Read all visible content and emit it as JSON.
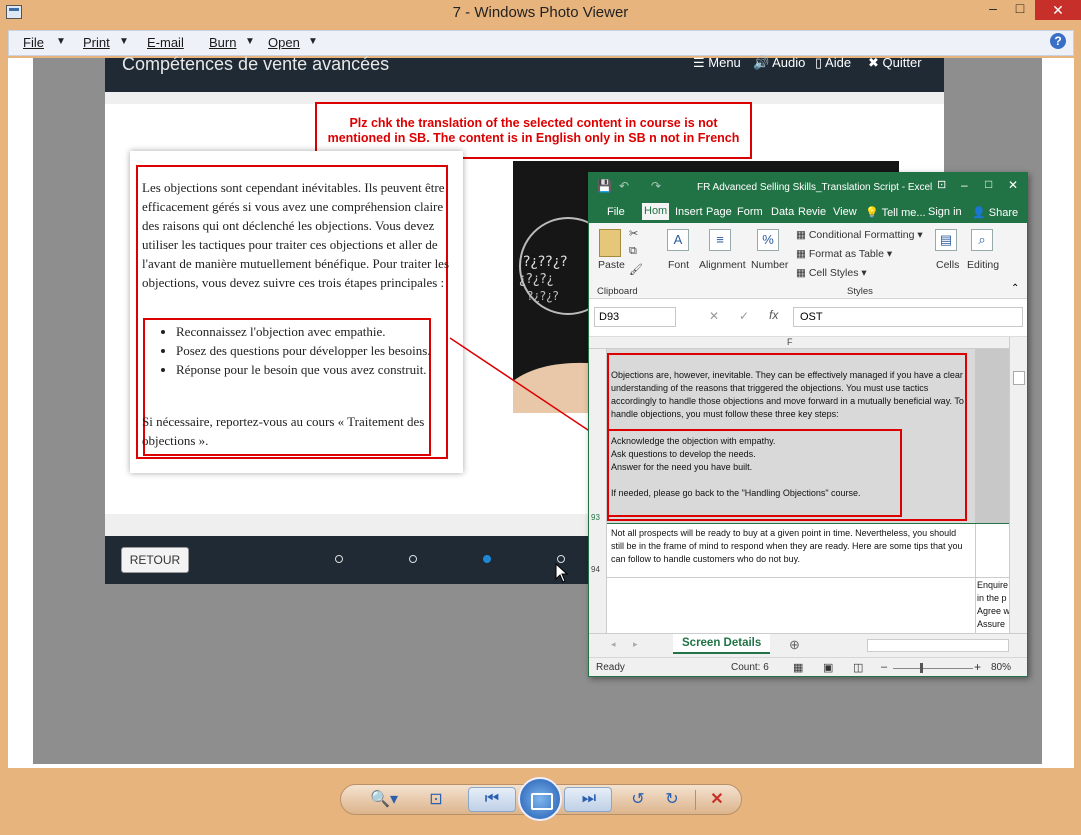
{
  "window": {
    "title": "7 - Windows Photo Viewer",
    "minimize": "–",
    "maximize": "□",
    "close": "✕"
  },
  "menu": {
    "items": [
      {
        "label": "File"
      },
      {
        "label": "Print"
      },
      {
        "label": "E-mail"
      },
      {
        "label": "Burn"
      },
      {
        "label": "Open"
      }
    ],
    "help": "?"
  },
  "slide": {
    "title": "Compétences de vente avancées",
    "header_items": [
      "☰ Menu",
      "🔊 Audio",
      "▯ Aide",
      "✖ Quitter"
    ],
    "note": "Plz chk the translation of the selected content in course is not mentioned in SB. The content is in English only in SB n not in French",
    "paragraph": "Les objections sont cependant inévitables. Ils peuvent être efficacement gérés si vous avez une compréhension claire des raisons qui ont déclenché les objections. Vous devez utiliser les tactiques pour traiter ces objections et aller de l'avant de manière mutuellement bénéfique. Pour traiter les objections, vous devez suivre ces trois étapes principales :",
    "bullets": [
      "Reconnaissez l'objection avec empathie.",
      "Posez des questions pour développer les besoins.",
      "Réponse pour le besoin que vous avez construit."
    ],
    "footnote": "Si nécessaire, reportez-vous au cours « Traitement des objections ».",
    "retour": "RETOUR"
  },
  "excel": {
    "title": "FR Advanced Selling Skills_Translation Script - Excel",
    "sign_in": "Sign in",
    "share": "Share",
    "tabs": [
      "File",
      "Hom",
      "Insert",
      "Page",
      "Form",
      "Data",
      "Revie",
      "View",
      "Tell me..."
    ],
    "ribbon": {
      "paste": "Paste",
      "clipboard": "Clipboard",
      "font": "Font",
      "alignment": "Alignment",
      "number": "Number",
      "number_icon": "%",
      "cond_format": "Conditional Formatting",
      "format_table": "Format as Table",
      "cell_styles": "Cell Styles",
      "styles": "Styles",
      "cells": "Cells",
      "editing": "Editing"
    },
    "name_box": "D93",
    "fx": "fx",
    "formula_value": "OST",
    "column_header": "F",
    "row_93_para": "Objections are, however, inevitable. They can be effectively managed if you have a clear understanding of the reasons that triggered the objections. You must use tactics accordingly to handle those objections and move forward in a mutually beneficial way. To handle objections, you must follow these three key steps:",
    "row_93_lines": [
      "Acknowledge the objection with empathy.",
      "Ask questions to develop the needs.",
      "Answer for the need you have built."
    ],
    "row_93_foot": "If needed, please go back to the \"Handling Objections\" course.",
    "row_94_text": "Not all prospects will be ready to buy at a given point in time. Nevertheless, you should still be in the frame of mind to respond when they are ready. Here are some tips that you can follow to handle customers who do not buy.",
    "row_95_side": [
      "Enquire",
      "in the p",
      "Agree w",
      "Assure"
    ],
    "row_numbers": [
      "93",
      "94"
    ],
    "sheet_tab": "Screen Details",
    "status_ready": "Ready",
    "status_count": "Count: 6",
    "zoom": "80%"
  },
  "toolbar": {
    "zoom": "🔍▾",
    "fit": "⊡",
    "prev": "⏮",
    "next": "⏭",
    "rotate_ccw": "↺",
    "rotate_cw": "↻",
    "delete": "✕"
  }
}
